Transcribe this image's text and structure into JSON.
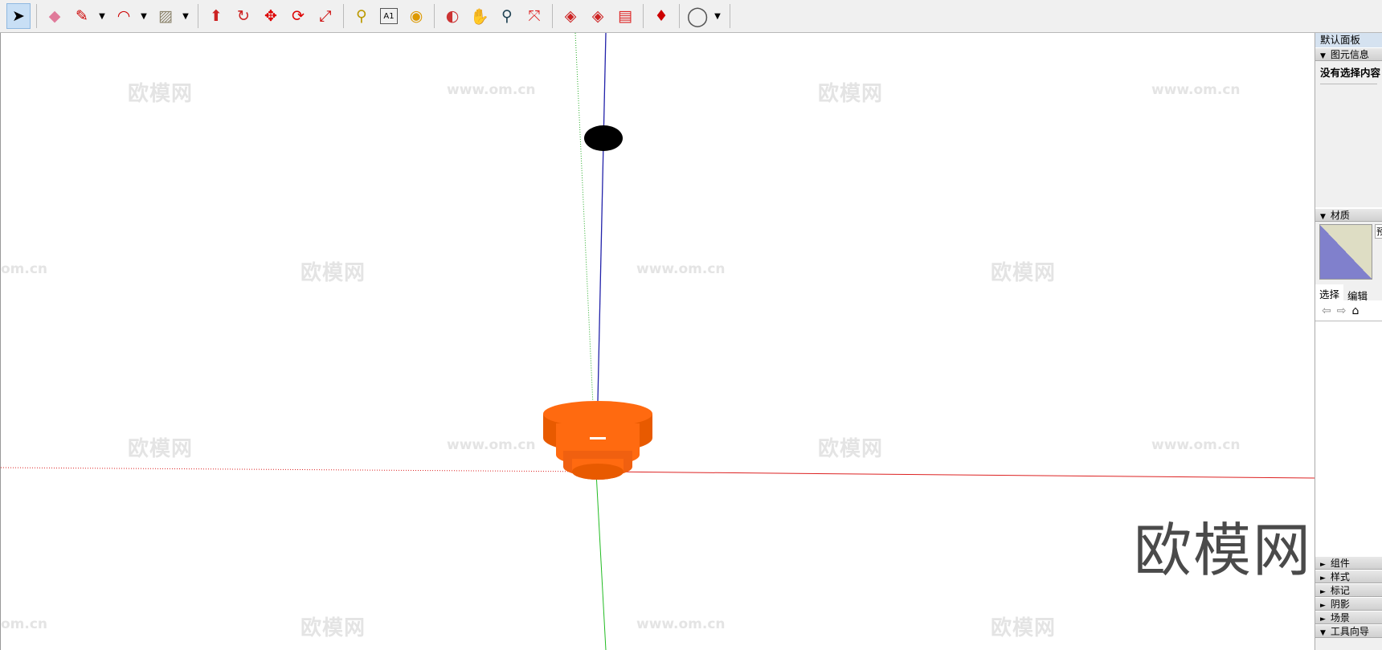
{
  "toolbar": {
    "tools": [
      {
        "name": "select-tool",
        "glyph": "➤"
      },
      {
        "name": "eraser-tool",
        "glyph": "◆"
      },
      {
        "name": "pencil-tool",
        "glyph": "✎"
      },
      {
        "name": "arc-tool",
        "glyph": "◠"
      },
      {
        "name": "rectangle-tool",
        "glyph": "▨"
      },
      {
        "name": "push-pull-tool",
        "glyph": "⬆"
      },
      {
        "name": "follow-me-tool",
        "glyph": "↻"
      },
      {
        "name": "move-tool",
        "glyph": "✥"
      },
      {
        "name": "rotate-tool",
        "glyph": "⟳"
      },
      {
        "name": "scale-tool",
        "glyph": "⤢"
      },
      {
        "name": "tape-measure-tool",
        "glyph": "⚲"
      },
      {
        "name": "text-tool",
        "glyph": "A1"
      },
      {
        "name": "paint-bucket-tool",
        "glyph": "◉"
      },
      {
        "name": "orbit-tool",
        "glyph": "◐"
      },
      {
        "name": "pan-tool",
        "glyph": "✋"
      },
      {
        "name": "zoom-tool",
        "glyph": "⚲"
      },
      {
        "name": "zoom-extents-tool",
        "glyph": "⤧"
      },
      {
        "name": "warehouse-tool",
        "glyph": "◈"
      },
      {
        "name": "extension-warehouse-tool",
        "glyph": "◈"
      },
      {
        "name": "send-to-layout-tool",
        "glyph": "▤"
      },
      {
        "name": "ruby-console-tool",
        "glyph": "♦"
      },
      {
        "name": "account-tool",
        "glyph": "◯"
      }
    ]
  },
  "watermark": {
    "logo": "欧模网",
    "url": "www.om.cn",
    "url_partial": "om.cn"
  },
  "panel": {
    "title": "默认面板",
    "entity_info": {
      "label": "图元信息",
      "empty_text": "没有选择内容"
    },
    "materials": {
      "label": "材质",
      "side_text": "预"
    },
    "tabs": [
      "选择",
      "编辑"
    ],
    "sections": [
      "组件",
      "样式",
      "标记",
      "阴影",
      "场景",
      "工具向导"
    ]
  },
  "colors": {
    "model": "#ff6a10",
    "model_dark": "#d84c00"
  }
}
